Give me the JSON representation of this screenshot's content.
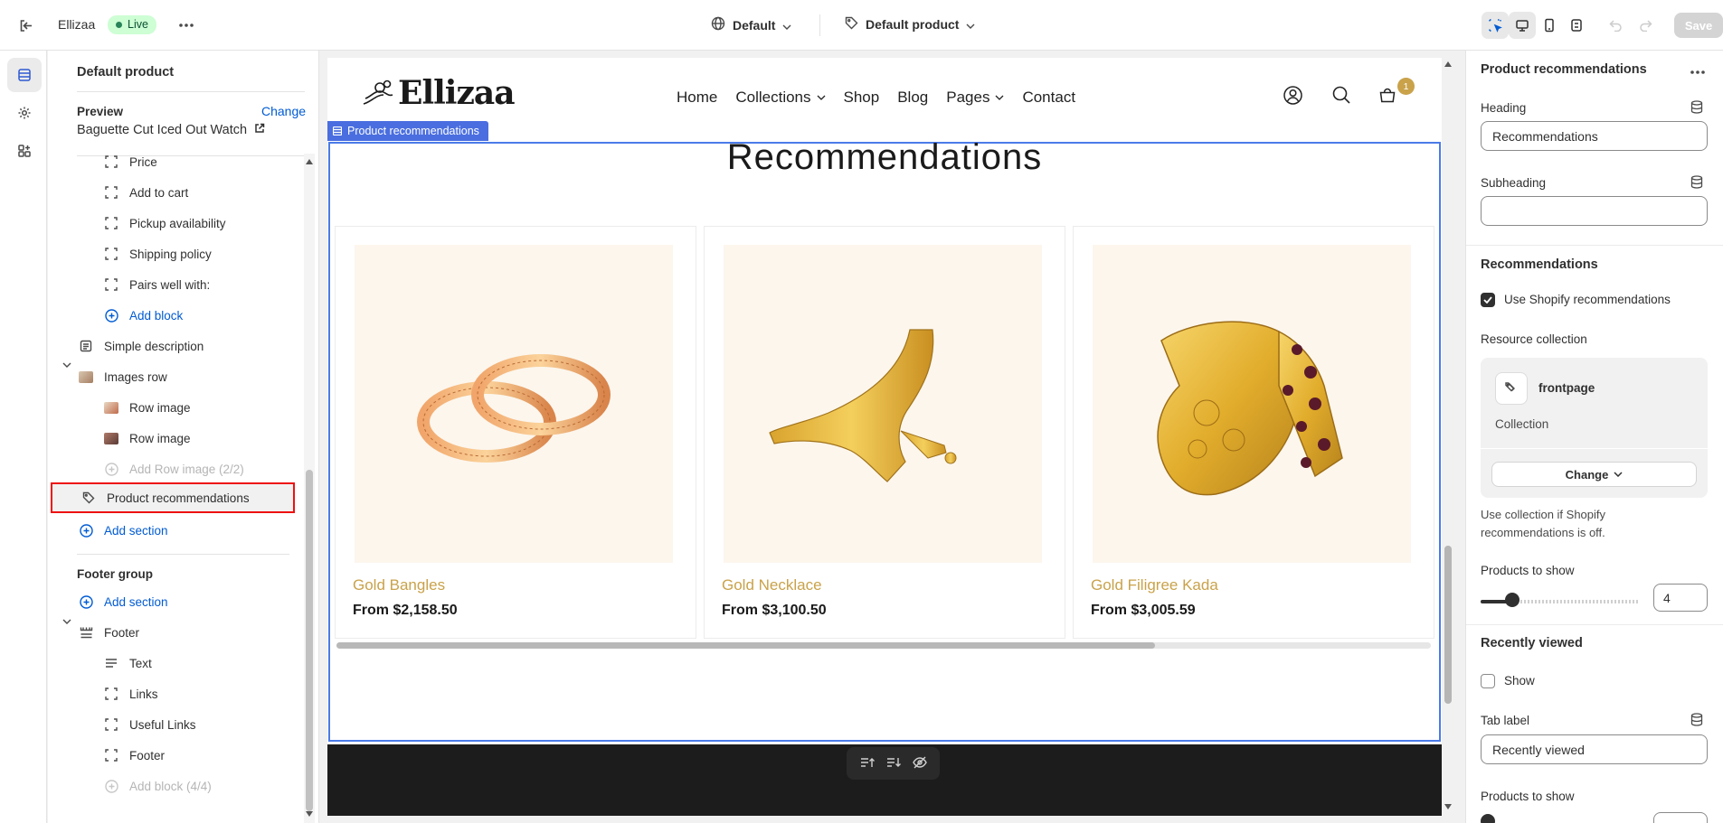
{
  "topbar": {
    "app_name": "Ellizaa",
    "status": "Live",
    "theme_select": "Default",
    "template_select": "Default product",
    "save_label": "Save"
  },
  "left_panel": {
    "title": "Default product",
    "preview_label": "Preview",
    "preview_change": "Change",
    "preview_value": "Baguette Cut Iced Out Watch",
    "rows": [
      {
        "label": "Price"
      },
      {
        "label": "Add to cart"
      },
      {
        "label": "Pickup availability"
      },
      {
        "label": "Shipping policy"
      },
      {
        "label": "Pairs well with:"
      },
      {
        "label": "Add block"
      },
      {
        "label": "Simple description"
      },
      {
        "label": "Images row"
      },
      {
        "label": "Row image"
      },
      {
        "label": "Row image"
      },
      {
        "label": "Add Row image (2/2)"
      },
      {
        "label": "Product recommendations"
      },
      {
        "label": "Add section"
      }
    ],
    "footer_group": {
      "title": "Footer group",
      "add_section": "Add section",
      "footer": "Footer",
      "children": [
        "Text",
        "Links",
        "Useful Links",
        "Footer"
      ],
      "add_block": "Add block (4/4)"
    }
  },
  "store": {
    "logo": "Ellizaa",
    "nav": [
      "Home",
      "Collections",
      "Shop",
      "Blog",
      "Pages",
      "Contact"
    ],
    "cart_count": "1",
    "section_tag": "Product recommendations",
    "heading": "Recommendations",
    "products": [
      {
        "name": "Gold Bangles",
        "price": "From $2,158.50"
      },
      {
        "name": "Gold Necklace",
        "price": "From $3,100.50"
      },
      {
        "name": "Gold Filigree Kada",
        "price": "From $3,005.59"
      }
    ]
  },
  "right_panel": {
    "title": "Product recommendations",
    "heading_label": "Heading",
    "heading_value": "Recommendations",
    "subheading_label": "Subheading",
    "subheading_value": "",
    "recommendations_title": "Recommendations",
    "use_shopify_label": "Use Shopify recommendations",
    "use_shopify_checked": true,
    "resource_label": "Resource collection",
    "resource_name": "frontpage",
    "resource_type": "Collection",
    "change_label": "Change",
    "help_text": "Use collection if Shopify recommendations is off.",
    "products_to_show_label": "Products to show",
    "products_to_show_value": "4",
    "products_to_show_fraction": 0.2,
    "recently_viewed_title": "Recently viewed",
    "show_label": "Show",
    "show_checked": false,
    "tab_label_label": "Tab label",
    "tab_label_value": "Recently viewed",
    "products_to_show_label_2": "Products to show"
  },
  "colors": {
    "accent_blue": "#005bd3",
    "selection_outline": "#4a7be8",
    "highlight_red": "#e11111",
    "gold": "#c9a24a"
  }
}
